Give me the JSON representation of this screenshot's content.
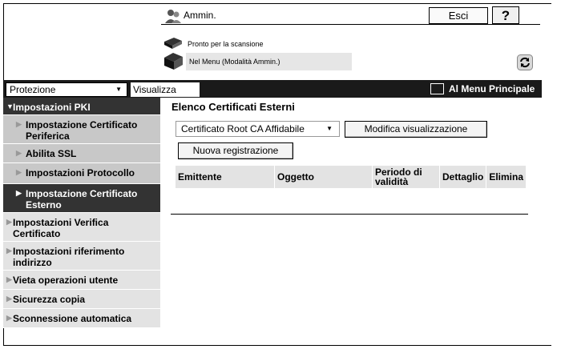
{
  "header": {
    "user_name": "Ammin.",
    "logout_label": "Esci",
    "help_label": "?",
    "status_scan": "Pronto per la scansione",
    "status_mode": "Nel Menu (Modalità Ammin.)"
  },
  "toolbar": {
    "category_selected": "Protezione",
    "view_label": "Visualizza",
    "main_menu_label": "Al Menu Principale"
  },
  "sidebar": {
    "items": [
      {
        "label": "Impostazioni PKI"
      },
      {
        "label": "Impostazione Certificato Periferica"
      },
      {
        "label": "Abilita SSL"
      },
      {
        "label": "Impostazioni Protocollo"
      },
      {
        "label": "Impostazione Certificato Esterno"
      },
      {
        "label": "Impostazioni Verifica Certificato"
      },
      {
        "label": "Impostazioni riferimento indirizzo"
      },
      {
        "label": "Vieta operazioni utente"
      },
      {
        "label": "Sicurezza copia"
      },
      {
        "label": "Sconnessione automatica"
      }
    ]
  },
  "main": {
    "title": "Elenco Certificati Esterni",
    "cert_type_selected": "Certificato Root CA Affidabile",
    "edit_view_label": "Modifica visualizzazione",
    "new_registration_label": "Nuova registrazione",
    "columns": [
      "Emittente",
      "Oggetto",
      "Periodo di validità",
      "Dettaglio",
      "Elimina"
    ]
  },
  "icons": {
    "user": "user-icon",
    "scanner": "scanner-icon",
    "printer": "printer-icon",
    "refresh": "refresh-icon",
    "menu": "menu-icon"
  },
  "colors": {
    "toolbar_bg": "#1a1a1a",
    "active_bg": "#333333",
    "sub_bg": "#c8c8c8",
    "item_bg": "#e3e3e3"
  }
}
